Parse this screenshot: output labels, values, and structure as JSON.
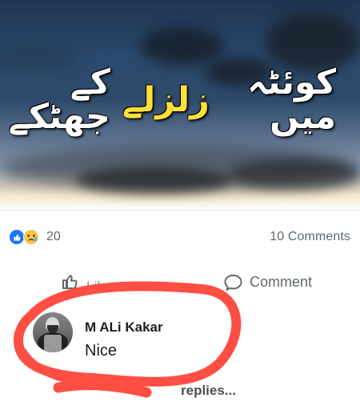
{
  "post": {
    "headline": {
      "part1": "کوئٹہ میں",
      "part2": "زلزلے",
      "part3": "کے جھٹکے"
    }
  },
  "stats": {
    "reaction_count": "20",
    "comments_count": "10 Comments"
  },
  "actions": {
    "like_label": "Like",
    "comment_label": "Comment"
  },
  "comment": {
    "author": "M ALi Kakar",
    "text": "Nice"
  },
  "replies": {
    "label": "replies..."
  },
  "colors": {
    "like_blue": "#1877f2",
    "sad_yellow": "#f7c84b",
    "highlight_red": "#ff4e43",
    "muted_text": "#606770",
    "comment_text": "#1c1e21",
    "headline_yellow": "#ffe03b"
  },
  "icons": {
    "like": "like-icon",
    "sad": "sad-icon",
    "like_outline": "like-outline-icon",
    "comment": "comment-icon"
  }
}
